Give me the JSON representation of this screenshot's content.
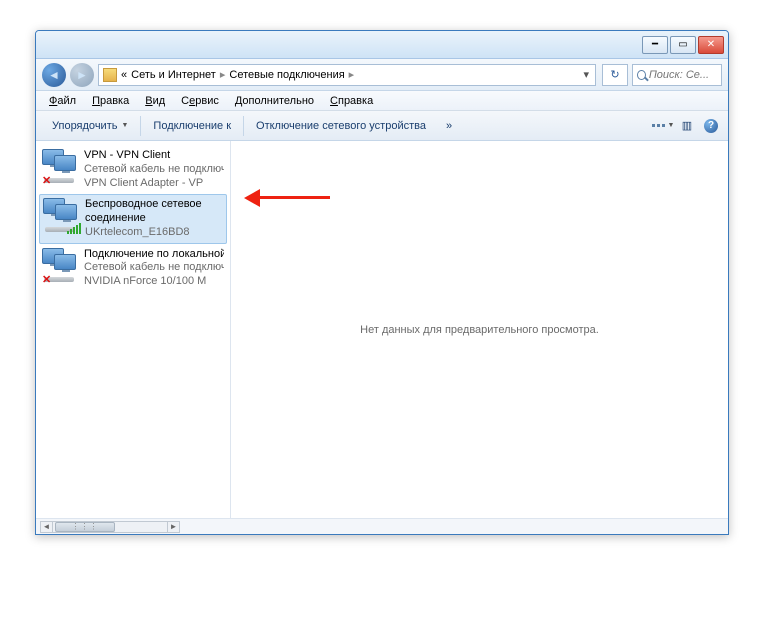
{
  "breadcrumb": {
    "prefix": "«",
    "level1": "Сеть и Интернет",
    "level2": "Сетевые подключения",
    "sep": "▸"
  },
  "search": {
    "placeholder": "Поиск: Се..."
  },
  "menu": {
    "file": "Файл",
    "edit": "Правка",
    "view": "Вид",
    "service": "Сервис",
    "advanced": "Дополнительно",
    "help": "Справка"
  },
  "toolbar": {
    "organize": "Упорядочить",
    "connect_to": "Подключение к",
    "disable_device": "Отключение сетевого устройства",
    "overflow": "»"
  },
  "connections": [
    {
      "title": "VPN - VPN Client",
      "status": "Сетевой кабель не подключен",
      "device": "VPN Client Adapter - VP",
      "disabled": true,
      "selected": false
    },
    {
      "title": "Беспроводное сетевое",
      "status": "соединение",
      "device": "UKrtelecom_E16BD8",
      "disabled": false,
      "selected": true
    },
    {
      "title": "Подключение по локальной сети",
      "status": "Сетевой кабель не подключен",
      "device": "NVIDIA nForce 10/100 M",
      "disabled": true,
      "selected": false
    }
  ],
  "preview": {
    "empty_text": "Нет данных для предварительного просмотра."
  }
}
